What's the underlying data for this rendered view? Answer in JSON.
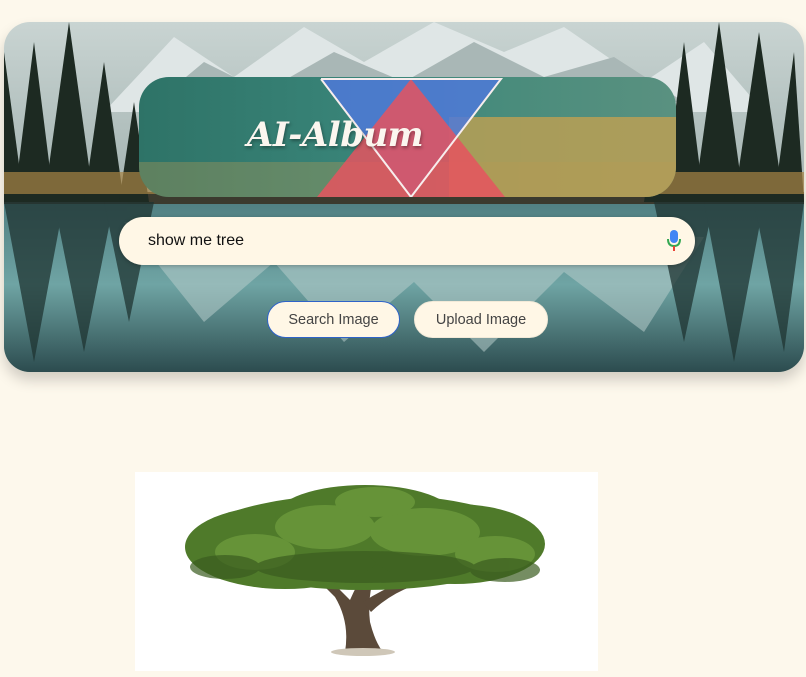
{
  "app": {
    "logo_title": "AI-Album"
  },
  "search": {
    "query": "show me tree",
    "mic_icon": "microphone-icon"
  },
  "buttons": {
    "search_label": "Search Image",
    "upload_label": "Upload Image"
  },
  "results": [
    {
      "subject": "tree"
    }
  ],
  "colors": {
    "page_background": "#fdf8ec",
    "search_background": "#fff7e6",
    "search_button_border": "#2f63c9",
    "logo_teal": "#3a867a",
    "logo_red": "#e5535f",
    "logo_blue": "#4f79d9"
  }
}
